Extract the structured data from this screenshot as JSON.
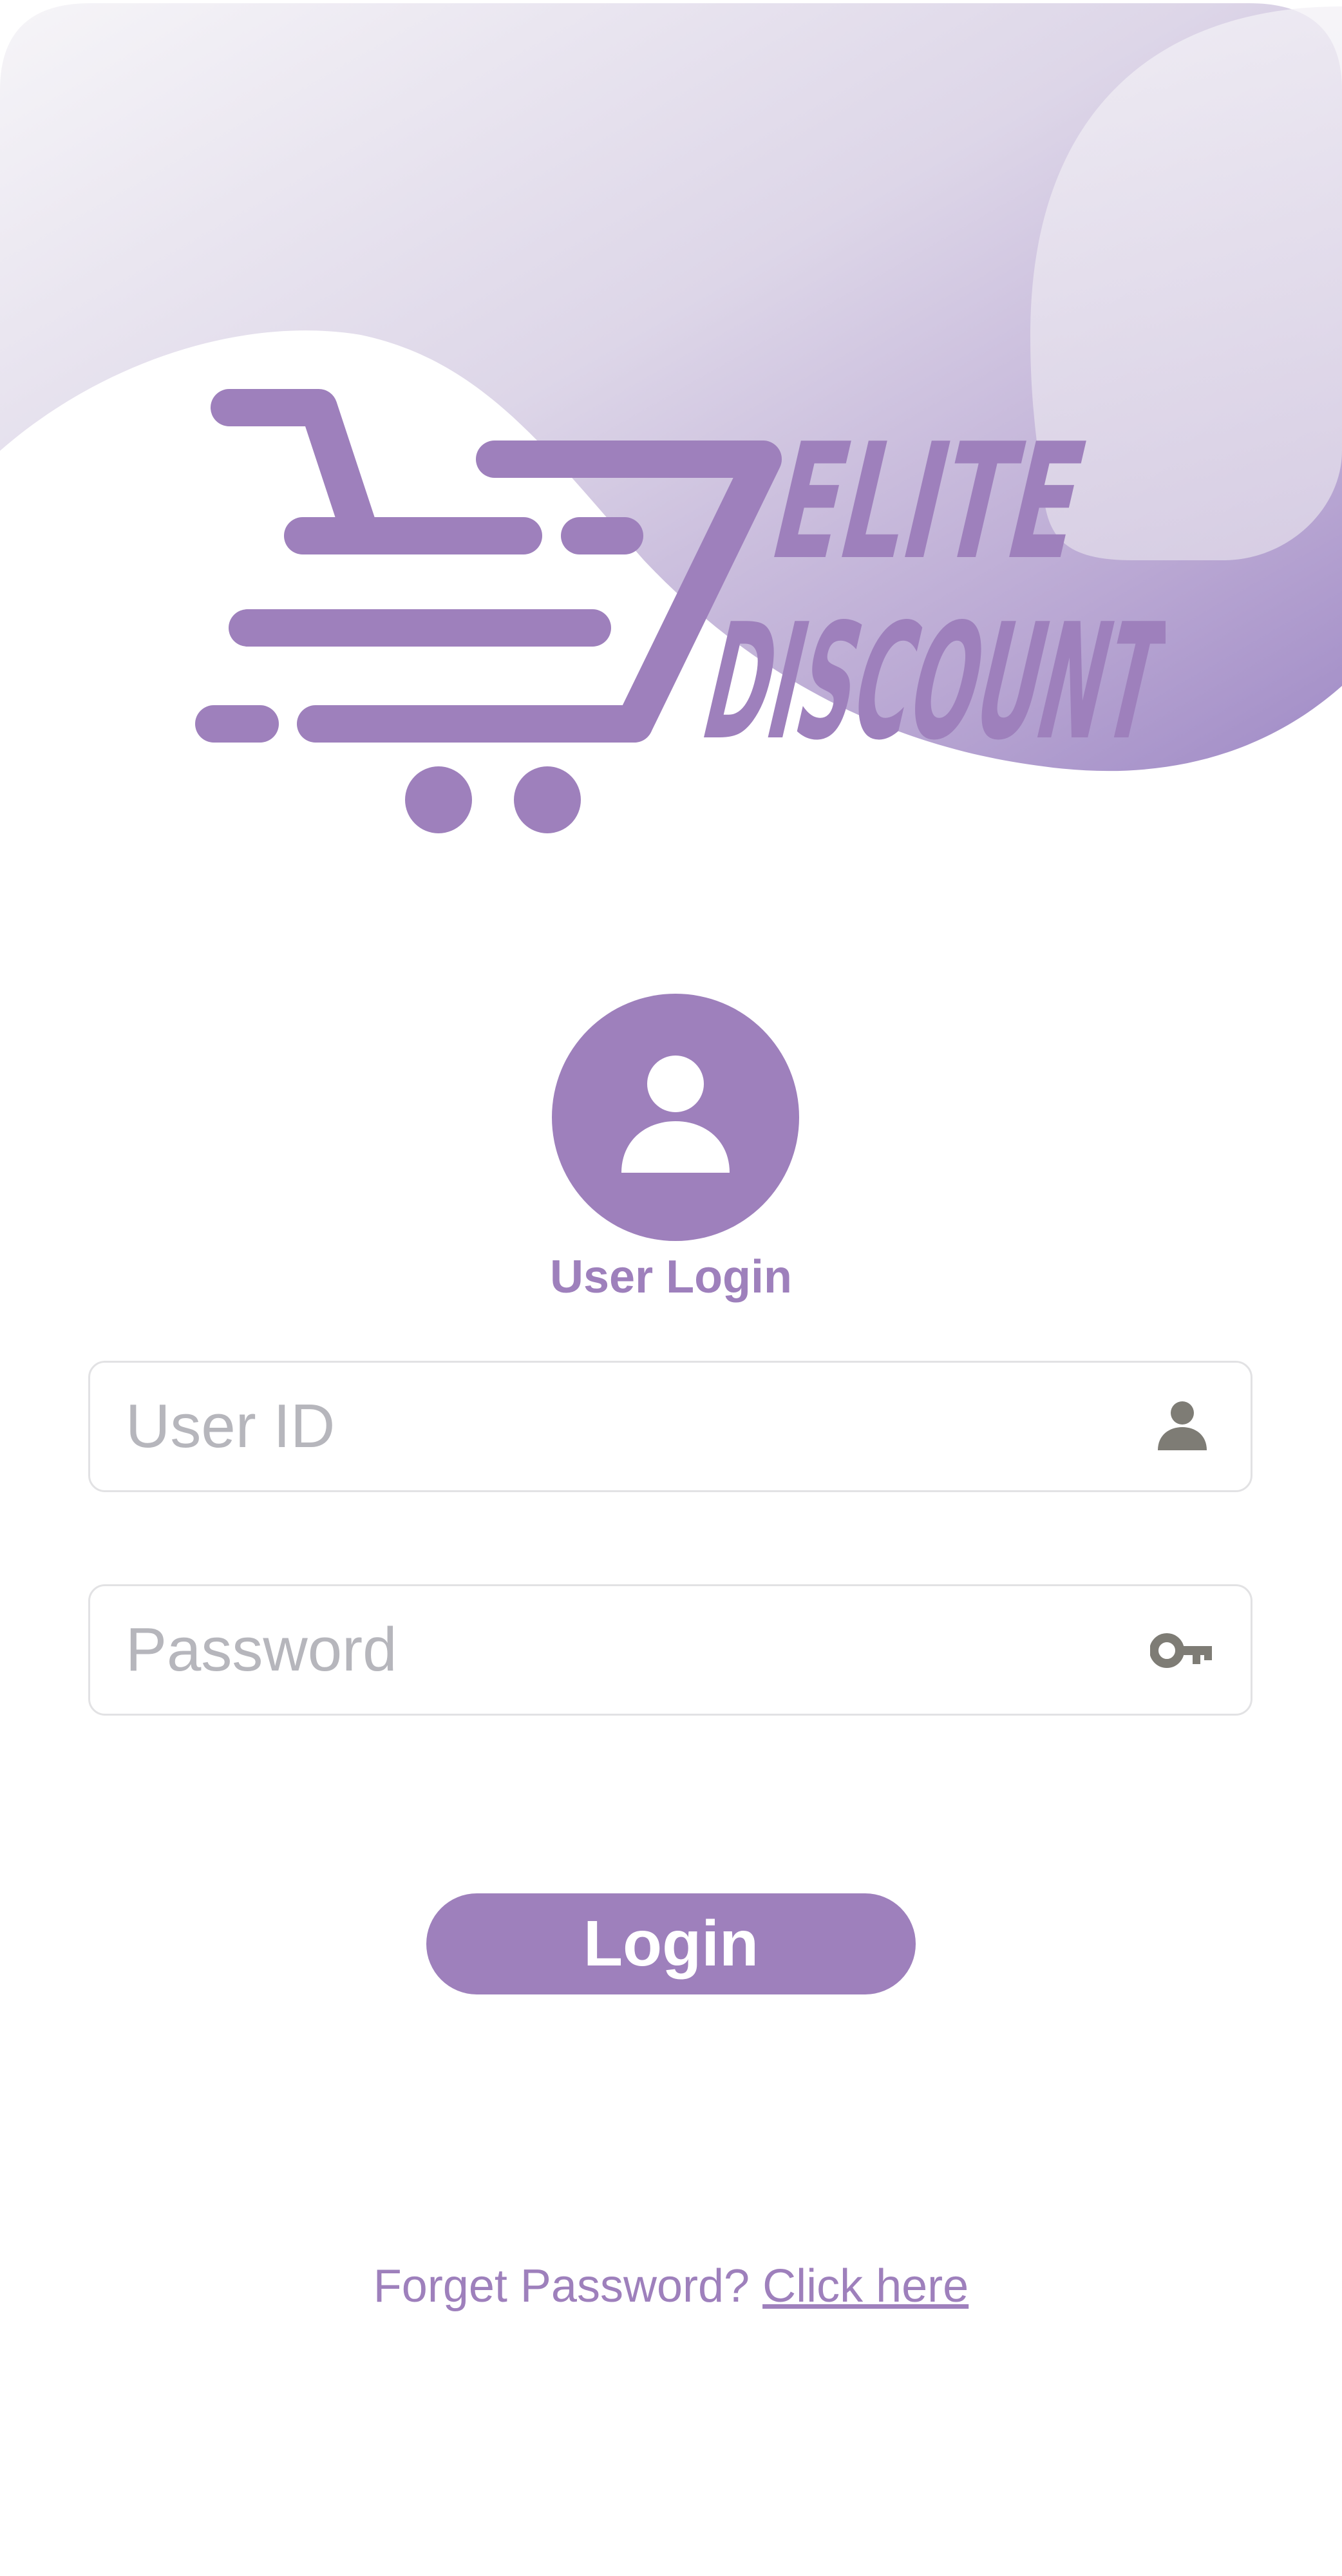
{
  "brand": {
    "logo_line1": "ELITE",
    "logo_line2": "DISCOUNT",
    "accent_color": "#9e80bc"
  },
  "login": {
    "avatar_icon": "user-circle-icon",
    "heading": "User Login",
    "userid_placeholder": "User ID",
    "userid_icon": "user-icon",
    "password_placeholder": "Password",
    "password_icon": "key-icon",
    "submit_label": "Login",
    "forgot_text": "Forget Password?",
    "forgot_link": "Click here"
  }
}
